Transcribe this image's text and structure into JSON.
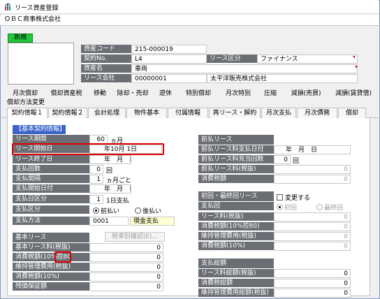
{
  "window": {
    "title": "リース資産登録",
    "company": "ＯＢＣ商事株式会社"
  },
  "header": {
    "new_label": "新規",
    "fields": [
      {
        "label": "資産コード",
        "value": "215-000019"
      },
      {
        "label": "契約No.",
        "value": "L4"
      },
      {
        "label": "資産名",
        "value": "車両"
      },
      {
        "label": "リース会社",
        "value": "00000001",
        "extra": "太平洋販売株式会社"
      }
    ],
    "lease_type_label": "リース区分",
    "lease_type_value": "ファイナンス"
  },
  "tabs_row1": [
    "月次償却",
    "償却資産税",
    "移動",
    "除却・売却",
    "遊休",
    "特別償却",
    "月次特別",
    "圧縮",
    "減損(売買)",
    "減損(賃貸借)"
  ],
  "tabs_row1b": [
    "償却方法変更"
  ],
  "tabs_row2": [
    "契約情報１",
    "契約情報２",
    "会計処理",
    "物件基本",
    "付属情報",
    "再リース・解約",
    "月次支払",
    "月次債務",
    "償却"
  ],
  "basic": {
    "header": "【基本契約情報】",
    "rows": [
      {
        "label": "リース期間",
        "value": "60",
        "unit": "ヵ月"
      },
      {
        "label": "リース開始日",
        "value": "年10月 1日"
      },
      {
        "label": "リース終了日",
        "value": "年　月　日"
      },
      {
        "label": "支払回数",
        "value": "0",
        "unit": "回"
      },
      {
        "label": "支払間隔",
        "value": "1",
        "unit": "ヵ月ごと"
      },
      {
        "label": "支払開始日付",
        "value": "年　月　日"
      },
      {
        "label": "支払日区分",
        "value": "1",
        "unit": "1日支払"
      },
      {
        "label": "支払区分",
        "opt1": "前払い",
        "opt2": "後払い"
      },
      {
        "label": "支払方法",
        "value": "0001",
        "unit": "現金支払"
      }
    ]
  },
  "base_lease": {
    "header": "基本リース",
    "button": "税率別確認(E)...",
    "rows": [
      {
        "label": "基本リース料(税抜)",
        "value": "0"
      },
      {
        "label": "消費税額(10%",
        "label_tail": "控80",
        "value": "0"
      },
      {
        "label": "維持管理費用(税抜)",
        "value": "0"
      },
      {
        "label": "消費税額(10%)",
        "value": "0"
      },
      {
        "label": "残価保証額",
        "value": "0"
      }
    ]
  },
  "prepaid": {
    "header": "前払リース",
    "rows": [
      {
        "label": "前払リース料支払日付",
        "value": "年　月　日"
      },
      {
        "label": "前払リース料充当回数",
        "value": "0",
        "unit": "回"
      },
      {
        "label": "前払リース料(税抜)",
        "value": "0"
      },
      {
        "label": "消費税額",
        "value": "0"
      }
    ]
  },
  "first_last": {
    "header": "初回・最終回リース",
    "checkbox": "変更する",
    "rows": [
      {
        "label": "支払回",
        "opt1": "初回",
        "opt2": "最終回"
      },
      {
        "label": "リース料(税抜)",
        "value": "0"
      },
      {
        "label": "消費税額(10%控80)",
        "value": "0"
      },
      {
        "label": "維持管理費用(税抜)",
        "value": "0"
      },
      {
        "label": "消費税額(10%)",
        "value": "0"
      }
    ]
  },
  "payment_total": {
    "header": "支払総額",
    "rows": [
      {
        "label": "リース料総額(税抜)",
        "value": "0"
      },
      {
        "label": "消費税総額",
        "value": "0"
      },
      {
        "label": "維持管理費用総額(税抜)",
        "value": "0"
      }
    ]
  }
}
